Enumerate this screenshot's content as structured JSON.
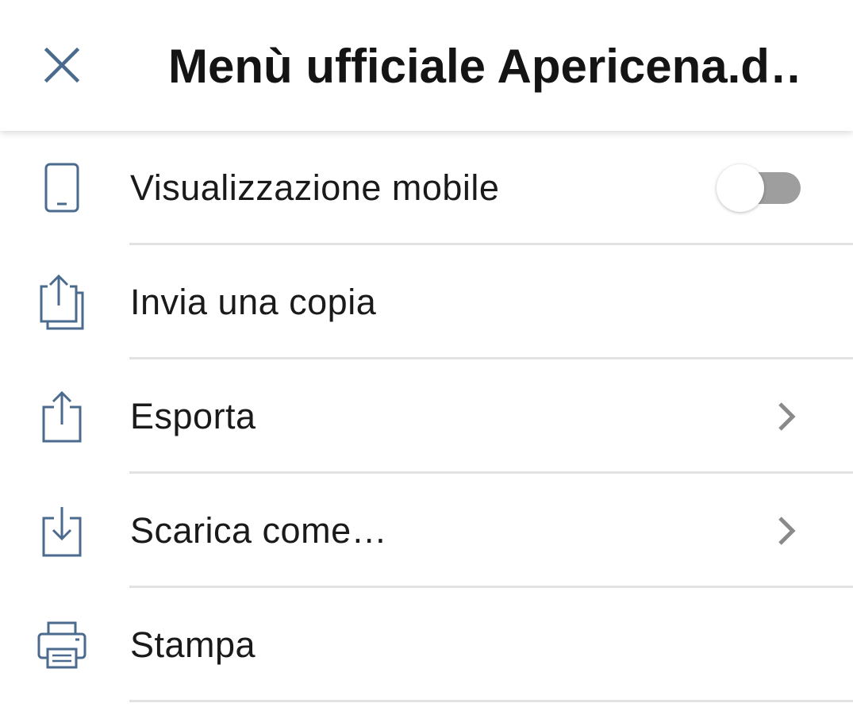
{
  "header": {
    "title": "Menù ufficiale Apericena.d…",
    "close_icon": "close-icon"
  },
  "colors": {
    "icon": "#4a6a8e",
    "text": "#1a1a1a",
    "divider": "#e2e2e2",
    "toggle_track_off": "#9e9e9e",
    "chevron": "#8a8a8a"
  },
  "menu": {
    "items": [
      {
        "label": "Visualizzazione mobile",
        "icon": "mobile-phone-icon",
        "control": "toggle",
        "toggle_on": false
      },
      {
        "label": "Invia una copia",
        "icon": "share-copy-icon",
        "control": "none"
      },
      {
        "label": "Esporta",
        "icon": "export-icon",
        "control": "chevron"
      },
      {
        "label": "Scarica come…",
        "icon": "download-icon",
        "control": "chevron"
      },
      {
        "label": "Stampa",
        "icon": "printer-icon",
        "control": "none"
      }
    ]
  }
}
